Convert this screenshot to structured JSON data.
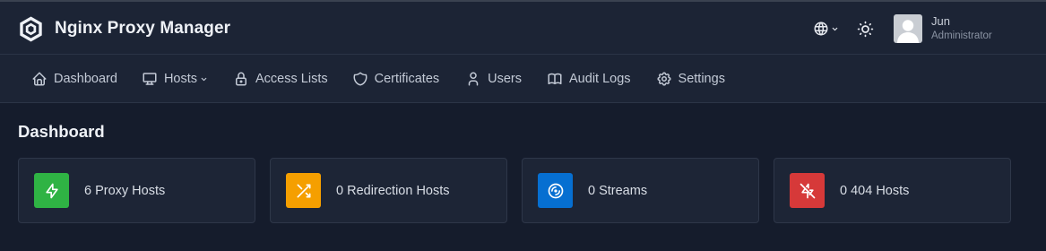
{
  "app": {
    "name": "Nginx Proxy Manager"
  },
  "user": {
    "name": "Jun",
    "role": "Administrator"
  },
  "nav": [
    {
      "label": "Dashboard",
      "icon": "home-icon"
    },
    {
      "label": "Hosts",
      "icon": "monitor-icon",
      "dropdown": true
    },
    {
      "label": "Access Lists",
      "icon": "lock-icon"
    },
    {
      "label": "Certificates",
      "icon": "shield-icon"
    },
    {
      "label": "Users",
      "icon": "user-icon"
    },
    {
      "label": "Audit Logs",
      "icon": "book-icon"
    },
    {
      "label": "Settings",
      "icon": "gear-icon"
    }
  ],
  "page": {
    "title": "Dashboard"
  },
  "cards": [
    {
      "label": "6 Proxy Hosts",
      "icon": "bolt-icon",
      "color": "#2fb344"
    },
    {
      "label": "0 Redirection Hosts",
      "icon": "shuffle-icon",
      "color": "#f59f00"
    },
    {
      "label": "0 Streams",
      "icon": "disc-icon",
      "color": "#066fd1"
    },
    {
      "label": "0 404 Hosts",
      "icon": "bolt-off-icon",
      "color": "#d63939"
    }
  ]
}
